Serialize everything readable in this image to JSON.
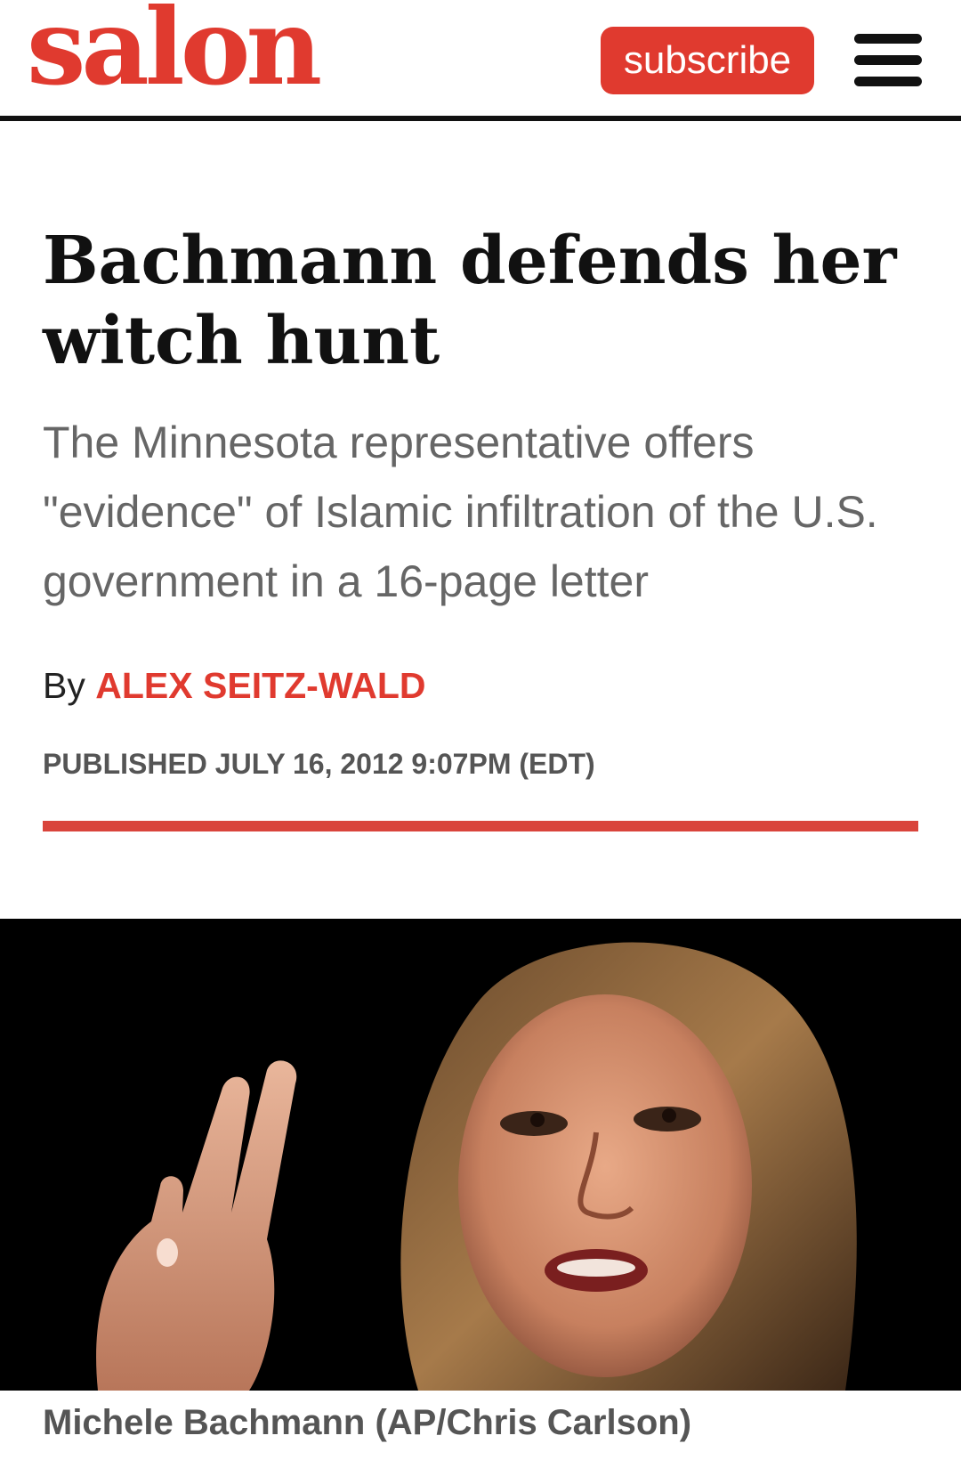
{
  "header": {
    "logo": "salon",
    "subscribe_label": "subscribe",
    "menu_icon": "hamburger-menu-icon"
  },
  "article": {
    "headline": "Bachmann defends her witch hunt",
    "dek": "The Minnesota representative offers \"evidence\" of Islamic infiltration of the U.S. government in a 16-page letter",
    "byline_prefix": "By",
    "author": "ALEX SEITZ-WALD",
    "published": "PUBLISHED JULY 16, 2012 9:07PM (EDT)",
    "caption": "Michele Bachmann (AP/Chris Carlson)"
  },
  "colors": {
    "brand_red": "#e03a2f",
    "rule_red": "#d9443b",
    "text_dark": "#111111",
    "text_gray": "#666666"
  }
}
